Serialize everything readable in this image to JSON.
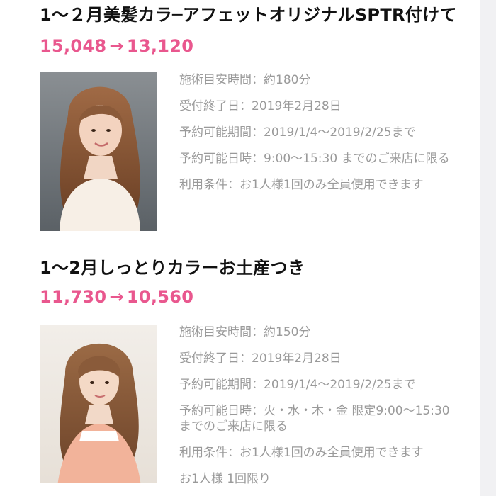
{
  "coupons": [
    {
      "title": "1～２月美髪カラ─アフェットオリジナルSPTR付けて",
      "price_before": "15,048",
      "arrow": "→",
      "price_after": "13,120",
      "details": [
        "施術目安時間：約180分",
        "受付終了日：2019年2月28日",
        "予約可能期間：2019/1/4～2019/2/25まで",
        "予約可能日時：9:00～15:30 までのご来店に限る",
        "利用条件：お1人様1回のみ全員使用できます"
      ]
    },
    {
      "title": "1～2月しっとりカラーお土産つき",
      "price_before": "11,730",
      "arrow": "→",
      "price_after": "10,560",
      "details": [
        "施術目安時間：約150分",
        "受付終了日：2019年2月28日",
        "予約可能期間：2019/1/4～2019/2/25まで",
        "予約可能日時：火・水・木・金 限定9:00～15:30 までのご来店に限る",
        "利用条件：お1人様1回のみ全員使用できます",
        "お1人様 1回限り"
      ]
    }
  ],
  "colors": {
    "title": "#111111",
    "price": "#e9578e",
    "detail": "#9a9a9a",
    "background": "#ffffff",
    "side_strip": "#f1f1f3"
  },
  "icons": {
    "photo_1": "model-photo-long-brown-wavy-hair",
    "photo_2": "model-photo-wavy-hair-with-bangs"
  }
}
